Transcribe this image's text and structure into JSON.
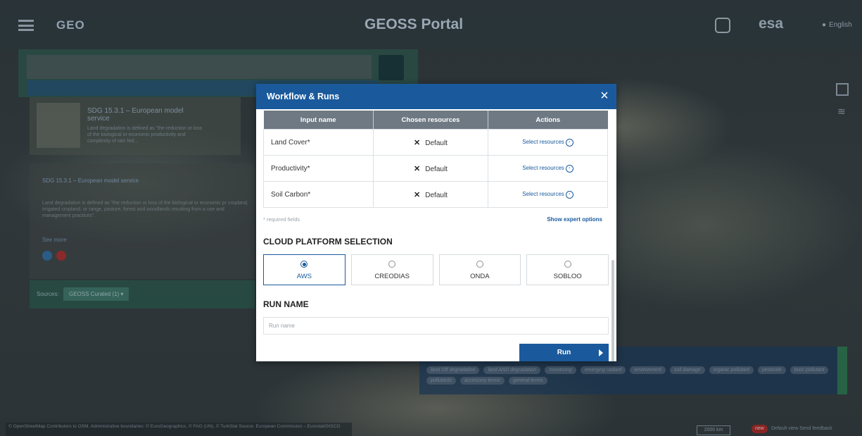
{
  "background": {
    "app_title": "GEOSS Portal",
    "brand": "GEO",
    "agency": "esa",
    "language": "English",
    "result_card": {
      "title": "SDG 15.3.1 – European model service",
      "description": "Land degradation is defined as \"the reduction or loss of the biological or economic productivity and complexity of rain fed..."
    },
    "detail": {
      "title": "SDG 15.3.1 – European model service",
      "text": "Land degradation is defined as \"the reduction or loss of the biological or economic pr cropland, irrigated cropland, or range, pasture, forest and woodlands resulting from a use and management practices\".",
      "see_more": "See more"
    },
    "sources_label": "Sources:",
    "sources_value": "GEOSS Curated (1) ▾",
    "tags": [
      "land Off degradation",
      "land AND degradation",
      "monitoring",
      "emerging radiant",
      "environment",
      "soil damage",
      "organic pollutant",
      "pesticide",
      "toxic pollutant",
      "pollutants",
      "accessory terms",
      "general terms"
    ],
    "attribution": "© OpenStreetMap Contributors to OSM. Administrative boundaries: © EuroGeographics, © FAO (UN), © TurkStat Source: European Commission – Eurostat/GISCO",
    "scale": "2000 km",
    "new_badge": "new",
    "map_links": "Default view   Send feedback"
  },
  "modal": {
    "title": "Workflow & Runs",
    "close_label": "×",
    "columns": [
      "Input name",
      "Chosen resources",
      "Actions"
    ],
    "rows": [
      {
        "name": "Land Cover*",
        "chosen": "Default",
        "action": "Select resources"
      },
      {
        "name": "Productivity*",
        "chosen": "Default",
        "action": "Select resources"
      },
      {
        "name": "Soil Carbon*",
        "chosen": "Default",
        "action": "Select resources"
      }
    ],
    "remove_mark": "✕",
    "required_note": "* required fields",
    "expert_link": "Show expert options",
    "cloud_title": "CLOUD PLATFORM SELECTION",
    "platforms": [
      {
        "name": "AWS",
        "selected": true
      },
      {
        "name": "CREODIAS",
        "selected": false
      },
      {
        "name": "ONDA",
        "selected": false
      },
      {
        "name": "SOBLOO",
        "selected": false
      }
    ],
    "run_name_title": "RUN NAME",
    "run_name_placeholder": "Run name",
    "run_name_value": "",
    "run_button": "Run"
  },
  "colors": {
    "header_blue": "#1a5a9c",
    "table_header_gray": "#6f7983",
    "link_blue": "#1a5a9c"
  },
  "icons": [
    "hamburger-icon",
    "account-icon",
    "close-icon",
    "chevron-right-circle-icon",
    "radio-icon",
    "play-arrow-icon",
    "layers-icon"
  ]
}
